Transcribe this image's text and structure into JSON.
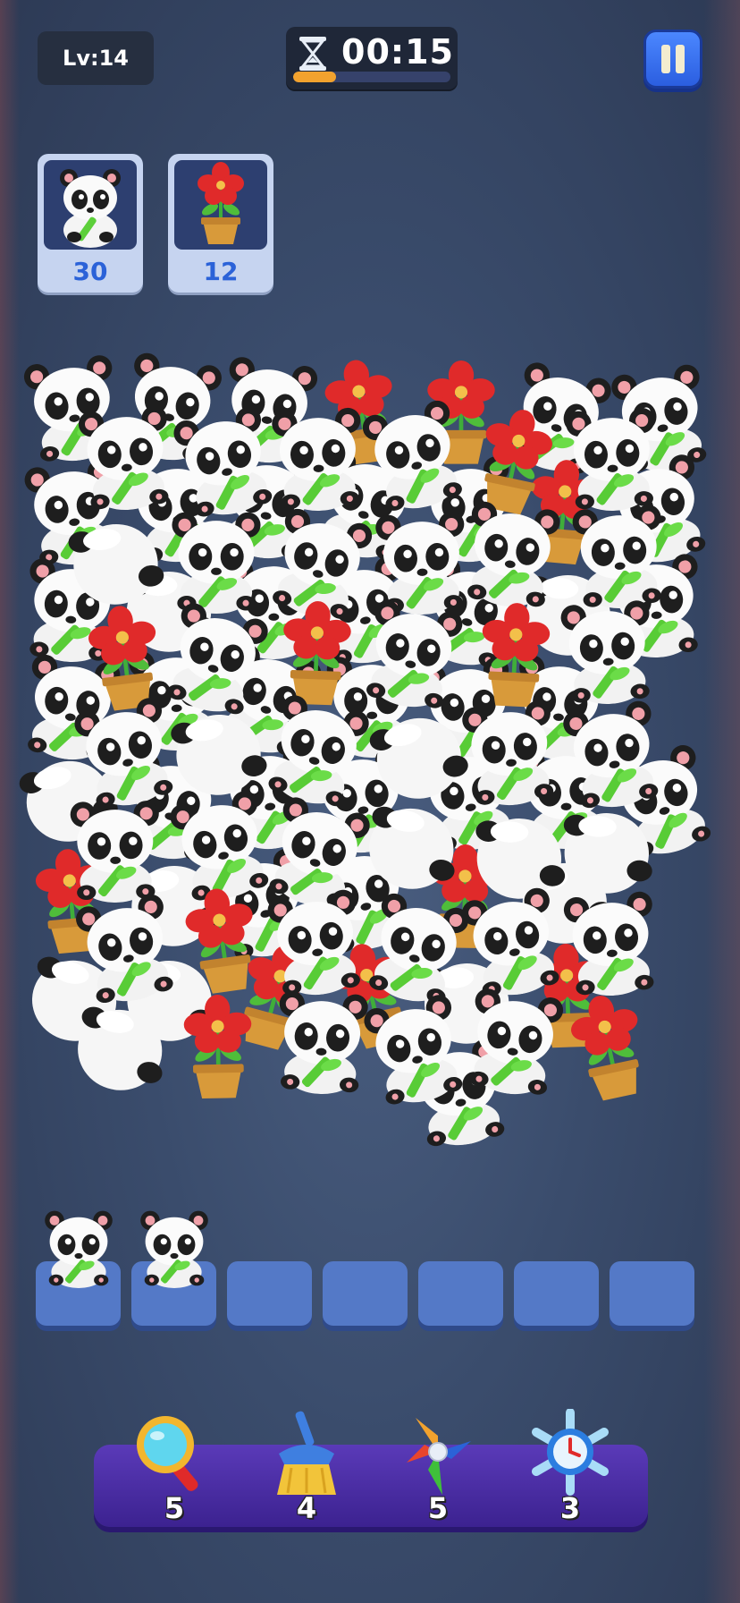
{
  "header": {
    "level_label": "Lv:14",
    "timer_text": "00:15",
    "timer_progress": 0.27
  },
  "goals": [
    {
      "item": "panda",
      "count": "30"
    },
    {
      "item": "flower-pot",
      "count": "12"
    }
  ],
  "slots": {
    "total": 7,
    "filled": [
      "panda",
      "panda"
    ]
  },
  "boosters": [
    {
      "name": "magnifier-icon",
      "count": "5"
    },
    {
      "name": "broom-icon",
      "count": "4"
    },
    {
      "name": "pinwheel-icon",
      "count": "5"
    },
    {
      "name": "freeze-clock-icon",
      "count": "3"
    }
  ],
  "colors": {
    "accent_blue": "#2b62d8",
    "timer_fill": "#f2a22e",
    "booster_bar": "#4a2ea4"
  }
}
